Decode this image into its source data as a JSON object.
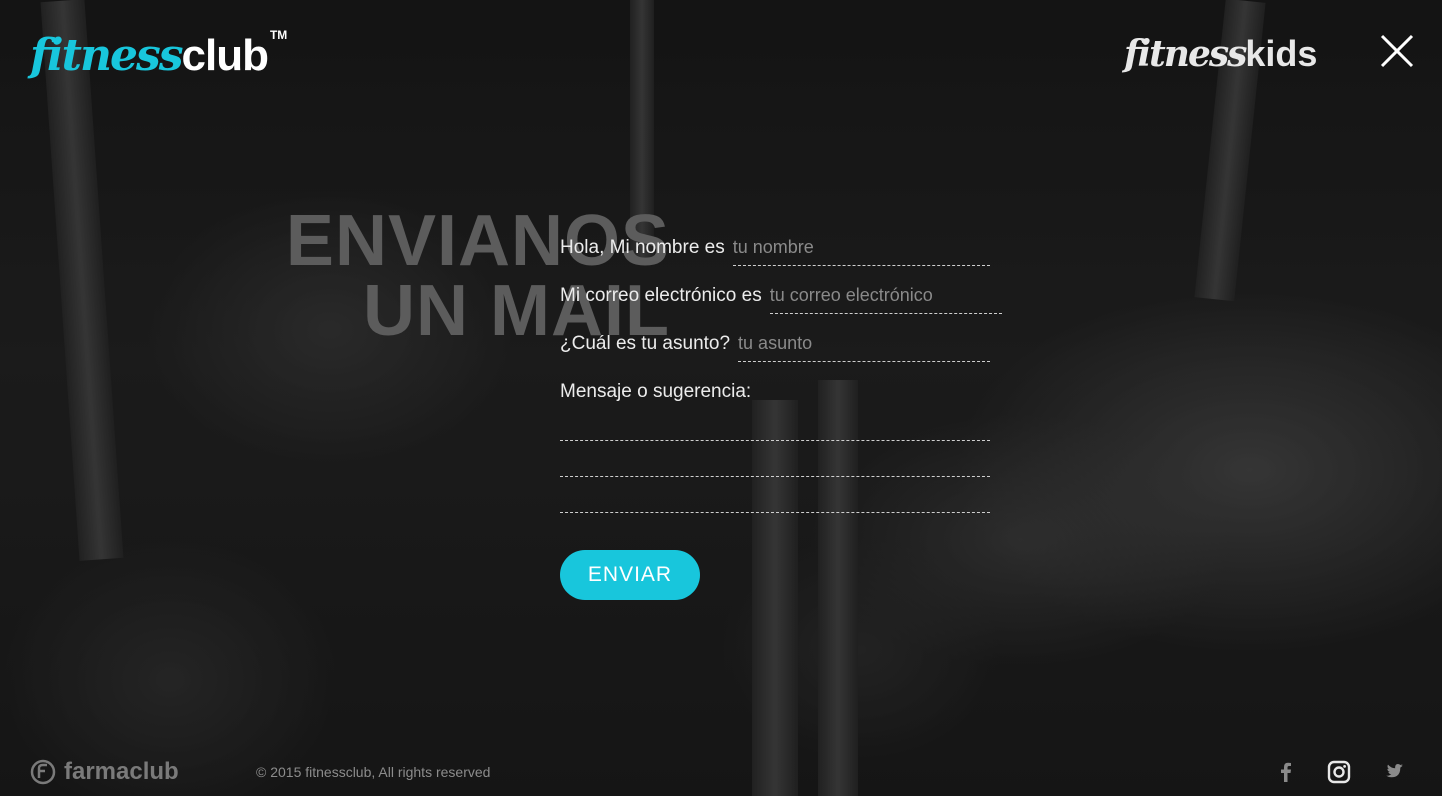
{
  "header": {
    "brand_script": "fitness",
    "brand_word": "club",
    "brand_tm": "TM",
    "kids_script": "fitness",
    "kids_word": "kids",
    "close_icon": "close-icon"
  },
  "headline": {
    "line1": "ENVIANOS",
    "line2": "UN MAIL"
  },
  "form": {
    "name_label": "Hola, Mi nombre es",
    "name_placeholder": "tu nombre",
    "email_label": "Mi correo electrónico es",
    "email_placeholder": "tu correo electrónico",
    "subject_label": "¿Cuál es tu asunto?",
    "subject_placeholder": "tu asunto",
    "message_label": "Mensaje o sugerencia:",
    "send_label": "ENVIAR"
  },
  "footer": {
    "partner_name": "farmaclub",
    "copyright": "© 2015 fitnessclub, All rights reserved",
    "social": [
      "facebook-icon",
      "instagram-icon",
      "twitter-icon"
    ]
  },
  "colors": {
    "accent": "#18c6dc",
    "background": "#1a1a1a",
    "headline": "#5c5c5c"
  }
}
